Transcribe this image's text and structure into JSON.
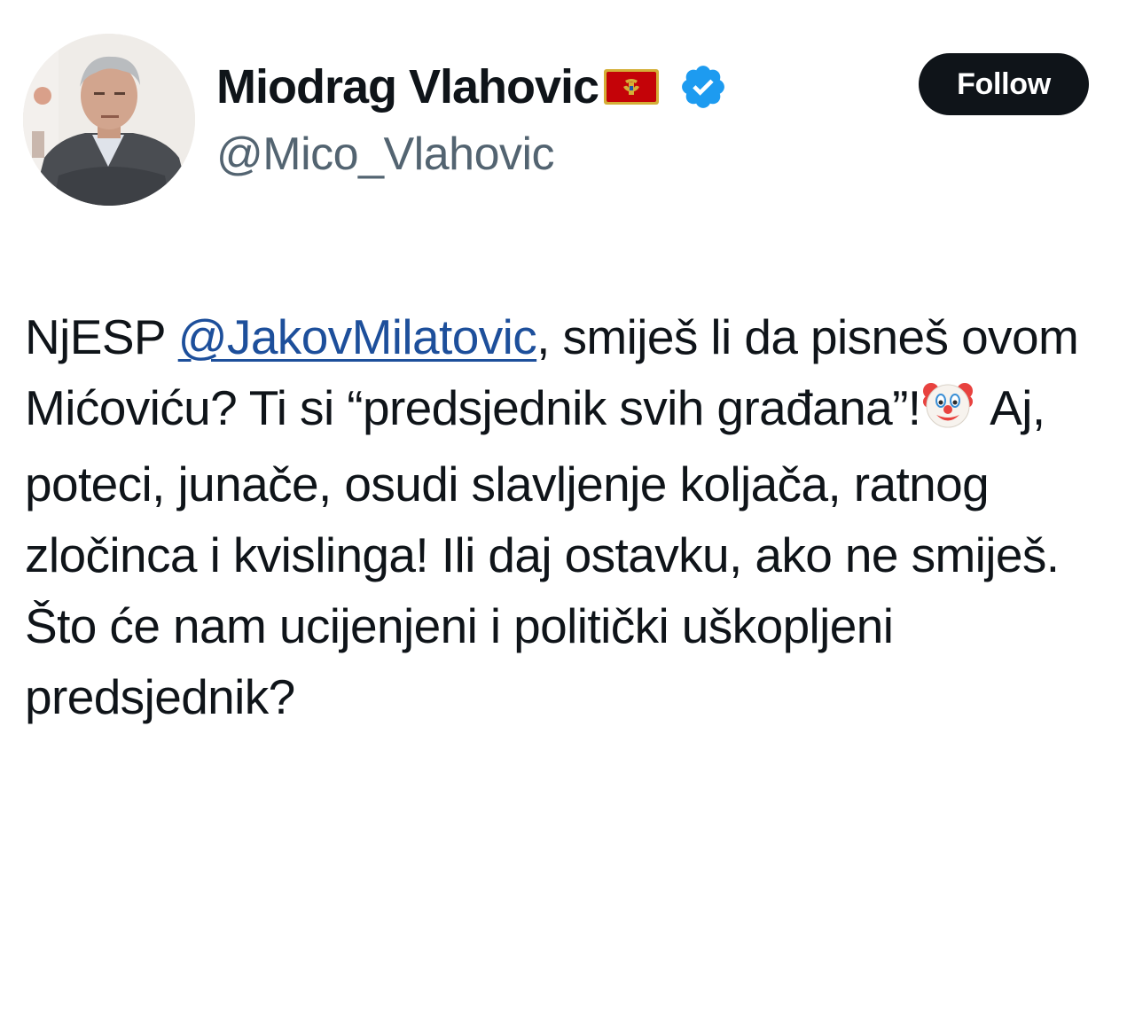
{
  "author": {
    "display_name": "Miodrag Vlahovic",
    "handle": "@Mico_Vlahovic",
    "flag_icon": "montenegro-flag-icon",
    "verified_icon": "verified-badge-icon",
    "avatar_icon": "profile-photo"
  },
  "follow_button": {
    "label": "Follow"
  },
  "tweet": {
    "part1": "NjESP ",
    "mention": "@JakovMilatovic",
    "part2": ", smiješ li da pisneš ovom Mićoviću? Ti si “predsjednik svih građana”!",
    "emoji_icon": "clown-face-emoji",
    "part3": " Aj, poteci, junače, osudi slavljenje koljača, ratnog zločinca i kvislinga! Ili daj ostavku, ako ne smiješ. Što će nam ucijenjeni i politički uškopljeni predsjednik?"
  },
  "colors": {
    "text": "#0f1419",
    "secondary": "#536471",
    "mention": "#1d4f9b",
    "verified": "#1d9bf0",
    "button_bg": "#0f1419",
    "flag_red": "#c40308",
    "flag_gold": "#d4af37"
  }
}
